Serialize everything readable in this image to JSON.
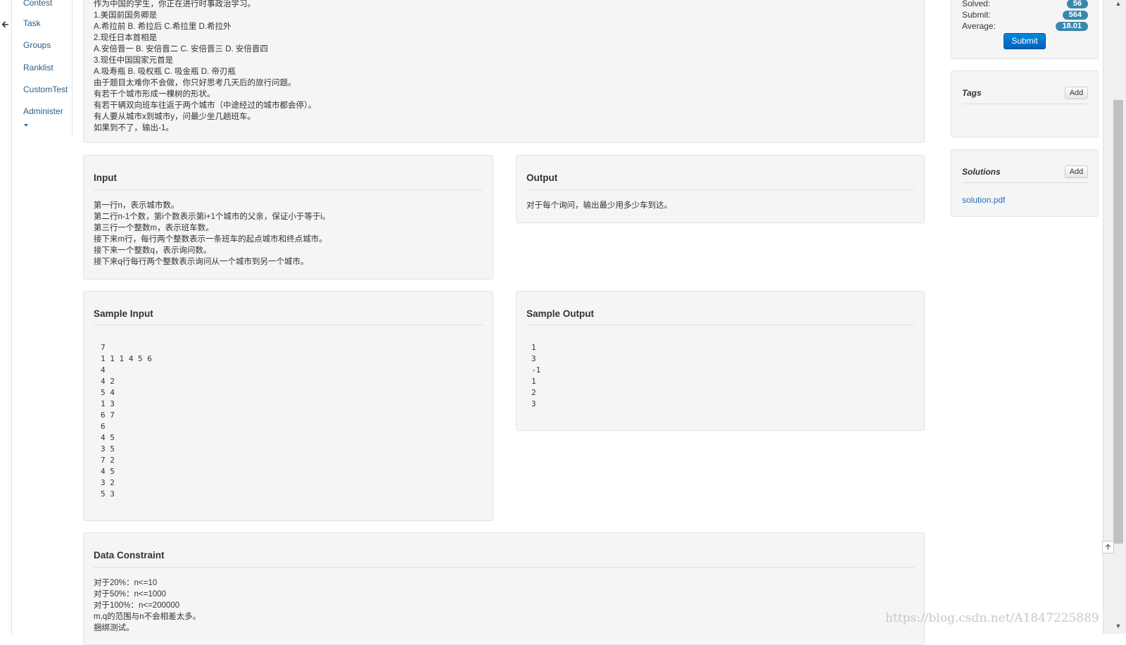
{
  "nav": {
    "back_icon": "arrow-left-icon",
    "items": [
      "Contest",
      "Task",
      "Groups",
      "Ranklist",
      "CustomTest",
      "Administer"
    ]
  },
  "description": {
    "lines": [
      "作为中国的学生，你正在进行时事政治学习。",
      "1.美国前国务卿是",
      "A.希拉前 B. 希拉后 C.希拉里 D.希拉外",
      "2.现任日本首相是",
      "A.安倍晋一 B. 安倍晋二 C. 安倍晋三 D. 安倍晋四",
      "3.现任中国国家元首是",
      "A.吸寿瓶 B. 吸权瓶 C. 吸金瓶 D. 帝刃瓶",
      "由于题目太难你不会做，你只好思考几天后的旅行问题。",
      "有若干个城市形成一棵树的形状。",
      "有若干辆双向班车往返于两个城市（中途经过的城市都会停）。",
      "有人要从城市x到城市y，问最少坐几趟班车。",
      "如果到不了，输出-1。"
    ]
  },
  "input": {
    "title": "Input",
    "lines": [
      "第一行n，表示城市数。",
      "第二行n-1个数，第i个数表示第i+1个城市的父亲，保证小于等于i。",
      "第三行一个整数m，表示班车数。",
      "接下来m行，每行两个整数表示一条班车的起点城市和终点城市。",
      "接下来一个整数q，表示询问数。",
      "接下来q行每行两个整数表示询问从一个城市到另一个城市。"
    ]
  },
  "output": {
    "title": "Output",
    "lines": [
      "对于每个询问，输出最少用多少车到达。"
    ]
  },
  "sample_input": {
    "title": "Sample Input",
    "lines": [
      "7",
      "1 1 1 4 5 6",
      "4",
      "4 2",
      "5 4",
      "1 3",
      "6 7",
      "6",
      "4 5",
      "3 5",
      "7 2",
      "4 5",
      "3 2",
      "5 3"
    ]
  },
  "sample_output": {
    "title": "Sample Output",
    "lines": [
      "1",
      "3",
      "-1",
      "1",
      "2",
      "3"
    ]
  },
  "constraint": {
    "title": "Data Constraint",
    "lines": [
      "对于20%：n<=10",
      "对于50%：n<=1000",
      "对于100%：n<=200000",
      "m,q的范围与n不会相差太多。",
      "捆绑测试。"
    ]
  },
  "stats": {
    "solved_label": "Solved:",
    "solved_value": "56",
    "submit_label": "Submit:",
    "submit_value": "564",
    "average_label": "Average:",
    "average_value": "18.01",
    "submit_button": "Submit"
  },
  "tags": {
    "title": "Tags",
    "add_label": "Add"
  },
  "solutions": {
    "title": "Solutions",
    "add_label": "Add",
    "file": "solution.pdf"
  },
  "scroll": {
    "totop_icon": "arrow-up-icon"
  },
  "watermark": "https://blog.csdn.net/A1847225889",
  "colors": {
    "accent": "#0074cc",
    "badge": "#3a87ad",
    "link": "#2a6ebb",
    "panel_bg": "#f5f5f5"
  }
}
